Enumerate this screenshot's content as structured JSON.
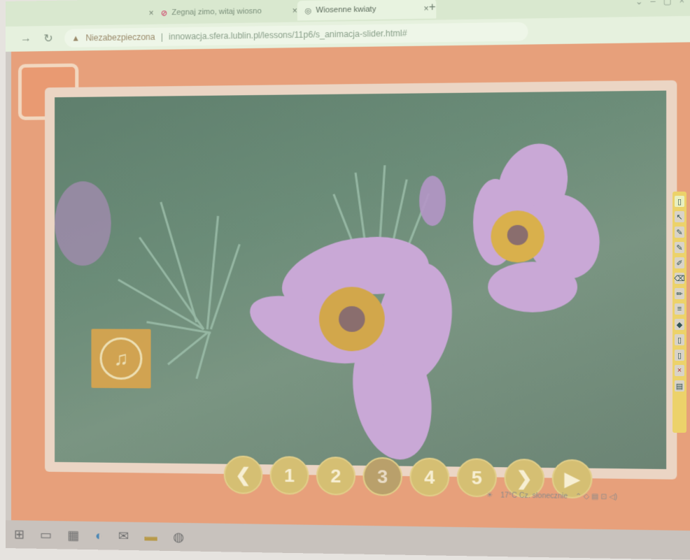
{
  "browser": {
    "tabs": [
      {
        "label": ""
      },
      {
        "label": "Zegnaj zimo, witaj wiosno"
      },
      {
        "label": "Wiosenne kwiaty"
      }
    ],
    "url_warning": "Niezabezpieczona",
    "url": "innowacja.sfera.lublin.pl/lessons/11p6/s_animacja-slider.html#"
  },
  "pager": {
    "buttons": [
      "❮",
      "1",
      "2",
      "3",
      "4",
      "5",
      "❯",
      "▶"
    ]
  },
  "tray": {
    "weather": "17°C  Cz. słonecznie"
  },
  "colors": {
    "lesson_bg": "#e7a07b",
    "pager_btn": "#d5bf73",
    "music_btn": "#d9a54e",
    "sidebar": "#ecd26a"
  }
}
